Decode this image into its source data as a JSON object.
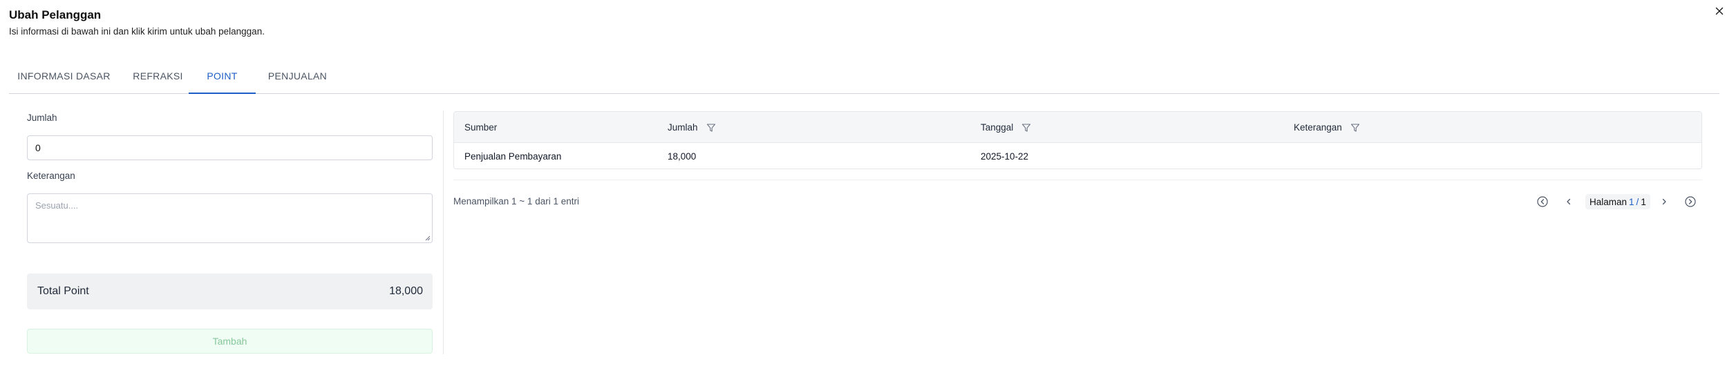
{
  "dialog": {
    "title": "Ubah Pelanggan",
    "subtitle": "Isi informasi di bawah ini dan klik kirim untuk ubah pelanggan.",
    "close_icon": "close-icon"
  },
  "tabs": [
    {
      "label": "INFORMASI DASAR",
      "active": false
    },
    {
      "label": "REFRAKSI",
      "active": false
    },
    {
      "label": "POINT",
      "active": true
    },
    {
      "label": "PENJUALAN",
      "active": false
    }
  ],
  "form": {
    "amount_label": "Jumlah",
    "amount_value": "0",
    "note_label": "Keterangan",
    "note_placeholder": "Sesuatu....",
    "total_label": "Total Point",
    "total_value": "18,000",
    "add_button": "Tambah"
  },
  "table": {
    "columns": [
      {
        "label": "Sumber",
        "filter": false
      },
      {
        "label": "Jumlah",
        "filter": true
      },
      {
        "label": "Tanggal",
        "filter": true
      },
      {
        "label": "Keterangan",
        "filter": true
      }
    ],
    "rows": [
      {
        "source": "Penjualan Pembayaran",
        "amount": "18,000",
        "date": "2025-10-22",
        "note": ""
      }
    ]
  },
  "pagination": {
    "summary": "Menampilkan 1 ~ 1 dari 1 entri",
    "page_label": "Halaman",
    "current": "1",
    "separator": "/",
    "total": "1"
  },
  "colors": {
    "accent": "#1d5fc7",
    "add_button_bg": "#f0fdf4",
    "add_button_text": "#86c79b",
    "total_bg": "#f0f1f3"
  }
}
